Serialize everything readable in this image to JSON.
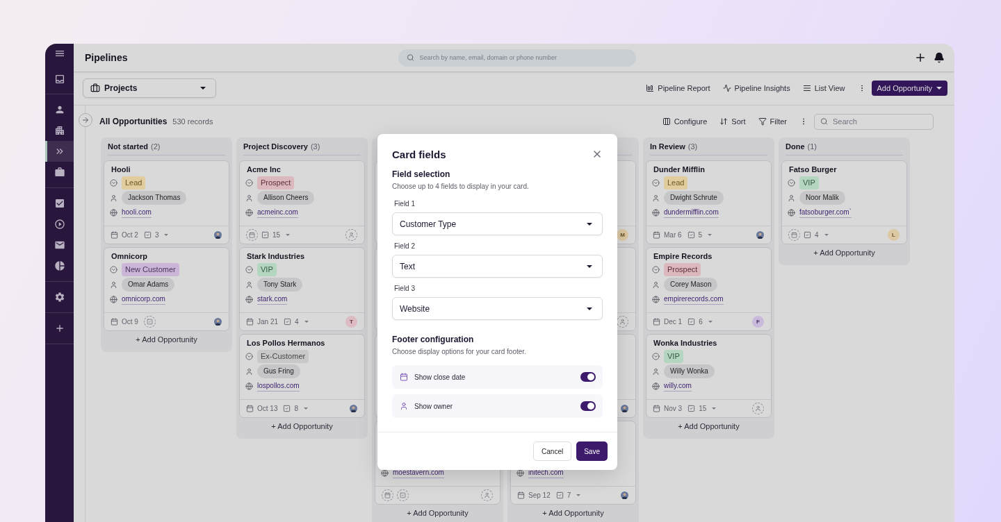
{
  "sidebar": {
    "items": [
      {
        "selected": false
      },
      {
        "selected": false
      },
      {
        "selected": false
      },
      {
        "selected": true
      },
      {
        "selected": false
      },
      {
        "selected": false
      },
      {
        "selected": false
      },
      {
        "selected": false
      },
      {
        "selected": false
      },
      {
        "selected": false
      },
      {
        "selected": false
      }
    ]
  },
  "topbar": {
    "title": "Pipelines",
    "search_placeholder": "Search by name, email, domain or phone number"
  },
  "toolbar": {
    "pipeline": "Projects",
    "actions": [
      "Pipeline Report",
      "Pipeline Insights",
      "List View"
    ],
    "primary_button": "Add Opportunity"
  },
  "view_bar": {
    "title": "All Opportunities",
    "count": "530 records",
    "actions": [
      "Configure",
      "Sort",
      "Filter"
    ],
    "search_placeholder": "Search"
  },
  "columns": [
    {
      "title": "Not started",
      "count": "(2)",
      "add_label": "+ Add Opportunity",
      "cards": [
        {
          "kind": "full",
          "name": "Hooli",
          "status": {
            "label": "Lead",
            "color": "#e0cc9c"
          },
          "owner": "Jackson Thomas",
          "website": "hooli.com",
          "date": "Oct 2",
          "tasks": "3",
          "avatar": {
            "kind": "photo"
          }
        },
        {
          "kind": "full",
          "name": "Omnicorp",
          "status": {
            "label": "New Customer",
            "color": "#cbb6d8"
          },
          "owner": "Omar Adams",
          "website": "omnicorp.com",
          "date": "Oct 9",
          "no_tasks": true,
          "avatar": {
            "kind": "photo"
          }
        }
      ]
    },
    {
      "title": "Project Discovery",
      "count": "(3)",
      "add_label": "+ Add Opportunity",
      "cards": [
        {
          "kind": "full",
          "name": "Acme Inc",
          "status": {
            "label": "Prospect",
            "color": "#dbb7be"
          },
          "owner": "Allison Cheers",
          "website": "acmeinc.com",
          "no_date": true,
          "tasks": "15",
          "avatar": {
            "kind": "empty"
          }
        },
        {
          "kind": "full",
          "name": "Stark Industries",
          "status": {
            "label": "VIP",
            "color": "#b4d6c0"
          },
          "owner": "Tony Stark",
          "website": "stark.com",
          "date": "Jan 21",
          "tasks": "4",
          "avatar": {
            "kind": "initial",
            "letter": "T",
            "color": "#dcbcc2"
          }
        },
        {
          "kind": "full",
          "name": "Los Pollos Hermanos",
          "status": {
            "label": "Ex-Customer",
            "color": "#c8c8c8"
          },
          "owner": "Gus Fring",
          "website": "lospollos.com",
          "date": "Oct 13",
          "tasks": "8",
          "avatar": {
            "kind": "photo"
          }
        }
      ]
    },
    {
      "add_label": "+ Add Opportunity",
      "cards": [
        {
          "kind": "covered"
        },
        {
          "kind": "covered"
        },
        {
          "kind": "covered"
        },
        {
          "kind": "partial",
          "website": "moestavern.com",
          "no_date": true,
          "no_tasks": true,
          "avatar": {
            "kind": "empty"
          }
        }
      ]
    },
    {
      "add_label": "+ Add Opportunity",
      "cards": [
        {
          "kind": "partial",
          "avatar": {
            "kind": "initial",
            "letter": "M",
            "color": "#dcc8a2"
          }
        },
        {
          "kind": "partial",
          "avatar": {
            "kind": "empty"
          }
        },
        {
          "kind": "partial",
          "avatar": {
            "kind": "photo"
          }
        },
        {
          "kind": "partial",
          "website": "initech.com",
          "date": "Sep 12",
          "tasks": "7",
          "avatar": {
            "kind": "photo"
          }
        }
      ]
    },
    {
      "title": "In Review",
      "count": "(3)",
      "add_label": "+ Add Opportunity",
      "cards": [
        {
          "kind": "full",
          "name": "Dunder Mifflin",
          "status": {
            "label": "Lead",
            "color": "#e0cc9c"
          },
          "owner": "Dwight Schrute",
          "website": "dundermifflin.com",
          "date": "Mar 6",
          "tasks": "5",
          "avatar": {
            "kind": "photo"
          }
        },
        {
          "kind": "full",
          "name": "Empire Records",
          "status": {
            "label": "Prospect",
            "color": "#dbb7be"
          },
          "owner": "Corey Mason",
          "website": "empirerecords.com",
          "date": "Dec 1",
          "tasks": "6",
          "avatar": {
            "kind": "initial",
            "letter": "F",
            "color": "#c9b9dc"
          }
        },
        {
          "kind": "full",
          "name": "Wonka Industries",
          "status": {
            "label": "VIP",
            "color": "#b4d6c0"
          },
          "owner": "Willy Wonka",
          "website": "willy.com",
          "date": "Nov 3",
          "tasks": "15",
          "avatar": {
            "kind": "empty"
          }
        }
      ]
    },
    {
      "title": "Done",
      "count": "(1)",
      "add_label": "+ Add Opportunity",
      "cards": [
        {
          "kind": "full",
          "name": "Fatso Burger",
          "status": {
            "label": "VIP",
            "color": "#b4d6c0"
          },
          "owner": "Noor Malik",
          "website": "fatsoburger.com`",
          "no_date": true,
          "tasks": "4",
          "avatar": {
            "kind": "initial",
            "letter": "L",
            "color": "#dcc8a2"
          }
        }
      ]
    }
  ],
  "modal": {
    "title": "Card fields",
    "field_selection": {
      "heading": "Field selection",
      "hint": "Choose up to 4 fields to display in your card.",
      "fields": [
        {
          "label": "Field 1",
          "value": "Customer Type"
        },
        {
          "label": "Field 2",
          "value": "Text"
        },
        {
          "label": "Field 3",
          "value": "Website"
        }
      ]
    },
    "footer_config": {
      "heading": "Footer configuration",
      "hint": "Choose display options for your card footer.",
      "toggles": [
        {
          "label": "Show close date",
          "on": true
        },
        {
          "label": "Show owner",
          "on": true
        }
      ]
    },
    "cancel": "Cancel",
    "save": "Save"
  }
}
